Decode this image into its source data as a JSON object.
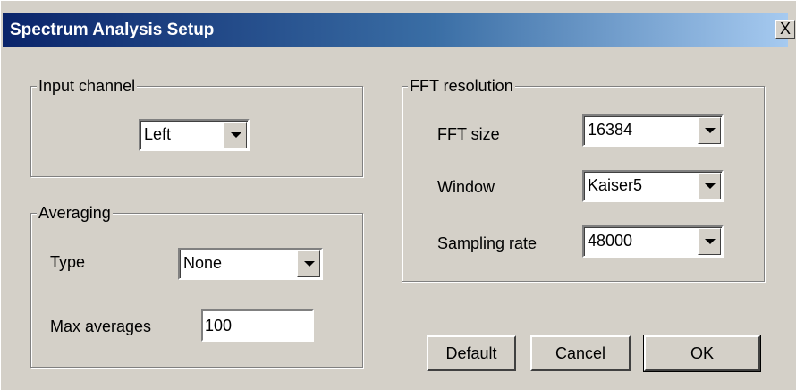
{
  "window": {
    "title": "Spectrum Analysis Setup",
    "close_glyph": "X"
  },
  "input_channel": {
    "legend": "Input channel",
    "selected": "Left"
  },
  "averaging": {
    "legend": "Averaging",
    "type_label": "Type",
    "type_selected": "None",
    "max_label": "Max averages",
    "max_value": "100"
  },
  "fft": {
    "legend": "FFT resolution",
    "size_label": "FFT size",
    "size_selected": "16384",
    "window_label": "Window",
    "window_selected": "Kaiser5",
    "rate_label": "Sampling rate",
    "rate_selected": "48000"
  },
  "buttons": {
    "default": "Default",
    "cancel": "Cancel",
    "ok": "OK"
  },
  "icons": [
    "close-icon",
    "chevron-down-icon"
  ]
}
